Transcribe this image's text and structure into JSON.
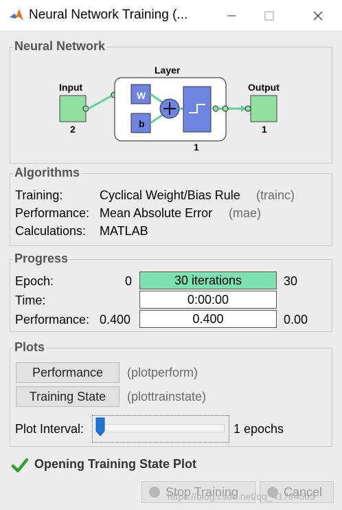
{
  "window": {
    "title": "Neural Network Training (...",
    "minimize_icon": "minimize-icon",
    "maximize_icon": "maximize-icon",
    "close_icon": "close-icon"
  },
  "network": {
    "panel_title": "Neural Network",
    "input_label": "Input",
    "input_size": "2",
    "layer_label": "Layer",
    "weight_label": "W",
    "bias_label": "b",
    "layer_size": "1",
    "output_label": "Output",
    "output_size": "1"
  },
  "algorithms": {
    "panel_title": "Algorithms",
    "rows": [
      {
        "label": "Training:",
        "value": "Cyclical Weight/Bias Rule",
        "fn": "(trainc)"
      },
      {
        "label": "Performance:",
        "value": "Mean Absolute Error",
        "fn": "(mae)"
      },
      {
        "label": "Calculations:",
        "value": "MATLAB",
        "fn": ""
      }
    ]
  },
  "progress": {
    "panel_title": "Progress",
    "epoch": {
      "label": "Epoch:",
      "start": "0",
      "value": "30 iterations",
      "end": "30",
      "fraction": 1.0
    },
    "time": {
      "label": "Time:",
      "value": "0:00:00"
    },
    "performance": {
      "label": "Performance:",
      "start": "0.400",
      "value": "0.400",
      "end": "0.00"
    }
  },
  "plots": {
    "panel_title": "Plots",
    "buttons": [
      {
        "label": "Performance",
        "fn": "(plotperform)"
      },
      {
        "label": "Training State",
        "fn": "(plottrainstate)"
      }
    ],
    "interval_label": "Plot Interval:",
    "interval_value": "1 epochs",
    "slider_level": 0
  },
  "status": {
    "icon": "checkmark-icon",
    "text": "Opening Training State Plot"
  },
  "footer": {
    "stop_label": "Stop Training",
    "cancel_label": "Cancel",
    "watermark": "https://blog.csdn.net/qq_41784565"
  },
  "colors": {
    "green_fill": "#7ee0b0",
    "node_green": "#8fe0a0",
    "weight_blue": "#6f83e0",
    "accent_blue": "#1e73d6",
    "check_green": "#2fa02f"
  }
}
